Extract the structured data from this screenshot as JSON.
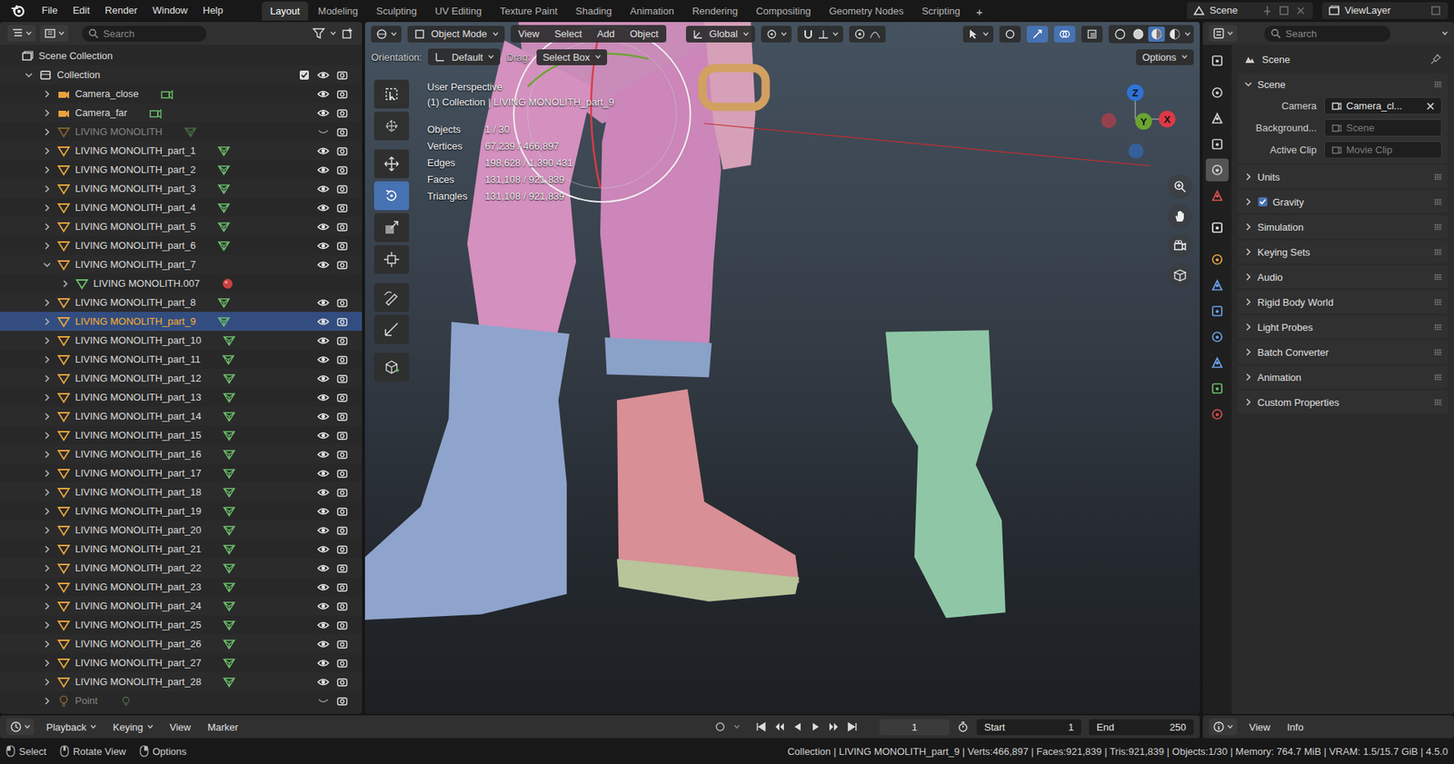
{
  "topbar": {
    "menus": [
      "File",
      "Edit",
      "Render",
      "Window",
      "Help"
    ],
    "workspaces": [
      {
        "label": "Layout",
        "selected": true
      },
      {
        "label": "Modeling",
        "selected": false
      },
      {
        "label": "Sculpting",
        "selected": false
      },
      {
        "label": "UV Editing",
        "selected": false
      },
      {
        "label": "Texture Paint",
        "selected": false
      },
      {
        "label": "Shading",
        "selected": false
      },
      {
        "label": "Animation",
        "selected": false
      },
      {
        "label": "Rendering",
        "selected": false
      },
      {
        "label": "Compositing",
        "selected": false
      },
      {
        "label": "Geometry Nodes",
        "selected": false
      },
      {
        "label": "Scripting",
        "selected": false
      }
    ],
    "add_workspace": "+",
    "scene": "Scene",
    "view_layer": "ViewLayer"
  },
  "outliner": {
    "search_placeholder": "Search",
    "rows": [
      {
        "label": "Scene Collection",
        "depth": 0,
        "kind": "scene",
        "expandable": false,
        "expanded": true,
        "selected": false,
        "greyed": false,
        "restrict": false,
        "visible": true,
        "data_icon": "none"
      },
      {
        "label": "Collection",
        "depth": 0,
        "kind": "collection",
        "expandable": true,
        "expanded": true,
        "selected": false,
        "greyed": false,
        "restrict": true,
        "visible": true,
        "data_icon": "none",
        "checked": true
      },
      {
        "label": "Camera_close",
        "depth": 1,
        "kind": "camera",
        "expandable": true,
        "expanded": false,
        "selected": false,
        "greyed": false,
        "restrict": true,
        "visible": true,
        "data_icon": "camera"
      },
      {
        "label": "Camera_far",
        "depth": 1,
        "kind": "camera",
        "expandable": true,
        "expanded": false,
        "selected": false,
        "greyed": false,
        "restrict": true,
        "visible": true,
        "data_icon": "camera"
      },
      {
        "label": "LIVING MONOLITH",
        "depth": 1,
        "kind": "mesh",
        "expandable": true,
        "expanded": false,
        "selected": false,
        "greyed": true,
        "restrict": true,
        "visible": false,
        "data_icon": "mesh"
      },
      {
        "label": "LIVING MONOLITH_part_1",
        "depth": 1,
        "kind": "mesh",
        "expandable": true,
        "expanded": false,
        "selected": false,
        "greyed": false,
        "restrict": true,
        "visible": true,
        "data_icon": "mesh"
      },
      {
        "label": "LIVING MONOLITH_part_2",
        "depth": 1,
        "kind": "mesh",
        "expandable": true,
        "expanded": false,
        "selected": false,
        "greyed": false,
        "restrict": true,
        "visible": true,
        "data_icon": "mesh"
      },
      {
        "label": "LIVING MONOLITH_part_3",
        "depth": 1,
        "kind": "mesh",
        "expandable": true,
        "expanded": false,
        "selected": false,
        "greyed": false,
        "restrict": true,
        "visible": true,
        "data_icon": "mesh"
      },
      {
        "label": "LIVING MONOLITH_part_4",
        "depth": 1,
        "kind": "mesh",
        "expandable": true,
        "expanded": false,
        "selected": false,
        "greyed": false,
        "restrict": true,
        "visible": true,
        "data_icon": "mesh"
      },
      {
        "label": "LIVING MONOLITH_part_5",
        "depth": 1,
        "kind": "mesh",
        "expandable": true,
        "expanded": false,
        "selected": false,
        "greyed": false,
        "restrict": true,
        "visible": true,
        "data_icon": "mesh"
      },
      {
        "label": "LIVING MONOLITH_part_6",
        "depth": 1,
        "kind": "mesh",
        "expandable": true,
        "expanded": false,
        "selected": false,
        "greyed": false,
        "restrict": true,
        "visible": true,
        "data_icon": "mesh"
      },
      {
        "label": "LIVING MONOLITH_part_7",
        "depth": 1,
        "kind": "mesh",
        "expandable": true,
        "expanded": true,
        "selected": false,
        "greyed": false,
        "restrict": true,
        "visible": true,
        "data_icon": "none"
      },
      {
        "label": "LIVING MONOLITH.007",
        "depth": 2,
        "kind": "meshdata",
        "expandable": true,
        "expanded": false,
        "selected": false,
        "greyed": false,
        "restrict": false,
        "visible": true,
        "data_icon": "material"
      },
      {
        "label": "LIVING MONOLITH_part_8",
        "depth": 1,
        "kind": "mesh",
        "expandable": true,
        "expanded": false,
        "selected": false,
        "greyed": false,
        "restrict": true,
        "visible": true,
        "data_icon": "mesh"
      },
      {
        "label": "LIVING MONOLITH_part_9",
        "depth": 1,
        "kind": "mesh",
        "expandable": true,
        "expanded": false,
        "selected": true,
        "greyed": false,
        "restrict": true,
        "visible": true,
        "data_icon": "mesh"
      },
      {
        "label": "LIVING MONOLITH_part_10",
        "depth": 1,
        "kind": "mesh",
        "expandable": true,
        "expanded": false,
        "selected": false,
        "greyed": false,
        "restrict": true,
        "visible": true,
        "data_icon": "mesh"
      },
      {
        "label": "LIVING MONOLITH_part_11",
        "depth": 1,
        "kind": "mesh",
        "expandable": true,
        "expanded": false,
        "selected": false,
        "greyed": false,
        "restrict": true,
        "visible": true,
        "data_icon": "mesh"
      },
      {
        "label": "LIVING MONOLITH_part_12",
        "depth": 1,
        "kind": "mesh",
        "expandable": true,
        "expanded": false,
        "selected": false,
        "greyed": false,
        "restrict": true,
        "visible": true,
        "data_icon": "mesh"
      },
      {
        "label": "LIVING MONOLITH_part_13",
        "depth": 1,
        "kind": "mesh",
        "expandable": true,
        "expanded": false,
        "selected": false,
        "greyed": false,
        "restrict": true,
        "visible": true,
        "data_icon": "mesh"
      },
      {
        "label": "LIVING MONOLITH_part_14",
        "depth": 1,
        "kind": "mesh",
        "expandable": true,
        "expanded": false,
        "selected": false,
        "greyed": false,
        "restrict": true,
        "visible": true,
        "data_icon": "mesh"
      },
      {
        "label": "LIVING MONOLITH_part_15",
        "depth": 1,
        "kind": "mesh",
        "expandable": true,
        "expanded": false,
        "selected": false,
        "greyed": false,
        "restrict": true,
        "visible": true,
        "data_icon": "mesh"
      },
      {
        "label": "LIVING MONOLITH_part_16",
        "depth": 1,
        "kind": "mesh",
        "expandable": true,
        "expanded": false,
        "selected": false,
        "greyed": false,
        "restrict": true,
        "visible": true,
        "data_icon": "mesh"
      },
      {
        "label": "LIVING MONOLITH_part_17",
        "depth": 1,
        "kind": "mesh",
        "expandable": true,
        "expanded": false,
        "selected": false,
        "greyed": false,
        "restrict": true,
        "visible": true,
        "data_icon": "mesh"
      },
      {
        "label": "LIVING MONOLITH_part_18",
        "depth": 1,
        "kind": "mesh",
        "expandable": true,
        "expanded": false,
        "selected": false,
        "greyed": false,
        "restrict": true,
        "visible": true,
        "data_icon": "mesh"
      },
      {
        "label": "LIVING MONOLITH_part_19",
        "depth": 1,
        "kind": "mesh",
        "expandable": true,
        "expanded": false,
        "selected": false,
        "greyed": false,
        "restrict": true,
        "visible": true,
        "data_icon": "mesh"
      },
      {
        "label": "LIVING MONOLITH_part_20",
        "depth": 1,
        "kind": "mesh",
        "expandable": true,
        "expanded": false,
        "selected": false,
        "greyed": false,
        "restrict": true,
        "visible": true,
        "data_icon": "mesh"
      },
      {
        "label": "LIVING MONOLITH_part_21",
        "depth": 1,
        "kind": "mesh",
        "expandable": true,
        "expanded": false,
        "selected": false,
        "greyed": false,
        "restrict": true,
        "visible": true,
        "data_icon": "mesh"
      },
      {
        "label": "LIVING MONOLITH_part_22",
        "depth": 1,
        "kind": "mesh",
        "expandable": true,
        "expanded": false,
        "selected": false,
        "greyed": false,
        "restrict": true,
        "visible": true,
        "data_icon": "mesh"
      },
      {
        "label": "LIVING MONOLITH_part_23",
        "depth": 1,
        "kind": "mesh",
        "expandable": true,
        "expanded": false,
        "selected": false,
        "greyed": false,
        "restrict": true,
        "visible": true,
        "data_icon": "mesh"
      },
      {
        "label": "LIVING MONOLITH_part_24",
        "depth": 1,
        "kind": "mesh",
        "expandable": true,
        "expanded": false,
        "selected": false,
        "greyed": false,
        "restrict": true,
        "visible": true,
        "data_icon": "mesh"
      },
      {
        "label": "LIVING MONOLITH_part_25",
        "depth": 1,
        "kind": "mesh",
        "expandable": true,
        "expanded": false,
        "selected": false,
        "greyed": false,
        "restrict": true,
        "visible": true,
        "data_icon": "mesh"
      },
      {
        "label": "LIVING MONOLITH_part_26",
        "depth": 1,
        "kind": "mesh",
        "expandable": true,
        "expanded": false,
        "selected": false,
        "greyed": false,
        "restrict": true,
        "visible": true,
        "data_icon": "mesh"
      },
      {
        "label": "LIVING MONOLITH_part_27",
        "depth": 1,
        "kind": "mesh",
        "expandable": true,
        "expanded": false,
        "selected": false,
        "greyed": false,
        "restrict": true,
        "visible": true,
        "data_icon": "mesh"
      },
      {
        "label": "LIVING MONOLITH_part_28",
        "depth": 1,
        "kind": "mesh",
        "expandable": true,
        "expanded": false,
        "selected": false,
        "greyed": false,
        "restrict": true,
        "visible": true,
        "data_icon": "mesh"
      },
      {
        "label": "Point",
        "depth": 1,
        "kind": "light",
        "expandable": true,
        "expanded": false,
        "selected": false,
        "greyed": true,
        "restrict": true,
        "visible": false,
        "data_icon": "light"
      }
    ]
  },
  "viewport": {
    "mode": "Object Mode",
    "menus": [
      "View",
      "Select",
      "Add",
      "Object"
    ],
    "transform": "Global",
    "toggles": [
      {
        "selected": false
      },
      {
        "selected": true
      },
      {
        "selected": true
      },
      {
        "selected": false
      }
    ],
    "shading": [
      {
        "selected": false
      },
      {
        "selected": false
      },
      {
        "selected": true
      },
      {
        "selected": false
      }
    ],
    "orientation_label": "Orientation:",
    "orientation": "Default",
    "drag_label": "Drag:",
    "drag": "Select Box",
    "options": "Options",
    "view_name": "User Perspective",
    "context": "(1) Collection | LIVING MONOLITH_part_9",
    "stats": [
      {
        "label": "Objects",
        "value": "1 / 30"
      },
      {
        "label": "Vertices",
        "value": "67,239 / 466,897"
      },
      {
        "label": "Edges",
        "value": "198,628 / 1,390,431"
      },
      {
        "label": "Faces",
        "value": "131,108 / 921,839"
      },
      {
        "label": "Triangles",
        "value": "131,108 / 921,839"
      }
    ],
    "tools": [
      {
        "selected": false
      },
      {
        "selected": false
      },
      {
        "selected": false
      },
      {
        "selected": true
      },
      {
        "selected": false
      },
      {
        "selected": false
      },
      {
        "selected": false
      },
      {
        "selected": false
      },
      {
        "selected": false
      }
    ],
    "axes": [
      {
        "label": "Z",
        "color": "#2f72d6"
      },
      {
        "label": "Y",
        "color": "#6ba531"
      },
      {
        "label": "X",
        "color": "#db3b46"
      }
    ]
  },
  "properties": {
    "search_placeholder": "Search",
    "context": "Scene",
    "tabs": [
      {
        "selected": false
      },
      {
        "selected": false
      },
      {
        "selected": false
      },
      {
        "selected": false
      },
      {
        "selected": true
      },
      {
        "selected": false
      },
      {
        "selected": false
      },
      {
        "selected": false
      },
      {
        "selected": false
      },
      {
        "selected": false
      },
      {
        "selected": false
      },
      {
        "selected": false
      },
      {
        "selected": false
      },
      {
        "selected": false
      }
    ],
    "panel": {
      "title": "Scene",
      "expanded": true,
      "fields": [
        {
          "label": "Camera",
          "value": "Camera_cl...",
          "greyed": false,
          "clearable": true
        },
        {
          "label": "Background...",
          "value": "Scene",
          "greyed": true,
          "clearable": false
        },
        {
          "label": "Active Clip",
          "value": "Movie Clip",
          "greyed": true,
          "clearable": false
        }
      ]
    },
    "sections": [
      {
        "label": "Units",
        "expanded": false,
        "kind": "plain",
        "checked": false
      },
      {
        "label": "Gravity",
        "expanded": false,
        "kind": "checkbox",
        "checked": true
      },
      {
        "label": "Simulation",
        "expanded": false,
        "kind": "plain",
        "checked": false
      },
      {
        "label": "Keying Sets",
        "expanded": false,
        "kind": "plain",
        "checked": false
      },
      {
        "label": "Audio",
        "expanded": false,
        "kind": "plain",
        "checked": false
      },
      {
        "label": "Rigid Body World",
        "expanded": false,
        "kind": "plain",
        "checked": false
      },
      {
        "label": "Light Probes",
        "expanded": false,
        "kind": "plain",
        "checked": false
      },
      {
        "label": "Batch Converter",
        "expanded": false,
        "kind": "plain",
        "checked": false
      },
      {
        "label": "Animation",
        "expanded": false,
        "kind": "plain",
        "checked": false
      },
      {
        "label": "Custom Properties",
        "expanded": false,
        "kind": "plain",
        "checked": false
      }
    ]
  },
  "timeline": {
    "menus": [
      {
        "label": "Playback",
        "dropdown": true
      },
      {
        "label": "Keying",
        "dropdown": true
      },
      {
        "label": "View",
        "dropdown": false
      },
      {
        "label": "Marker",
        "dropdown": false
      }
    ],
    "frame": "1",
    "start_label": "Start",
    "start": "1",
    "end_label": "End",
    "end": "250"
  },
  "info_editor": {
    "menus": [
      "View",
      "Info"
    ]
  },
  "status_bar": {
    "hints": [
      "Select",
      "Rotate View",
      "Options"
    ],
    "summary": "Collection | LIVING MONOLITH_part_9 | Verts:466,897 | Faces:921,839 | Tris:921,839 | Objects:1/30 | Memory: 764.7 MiB | VRAM: 1.5/15.7 GiB | 4.5.0"
  }
}
